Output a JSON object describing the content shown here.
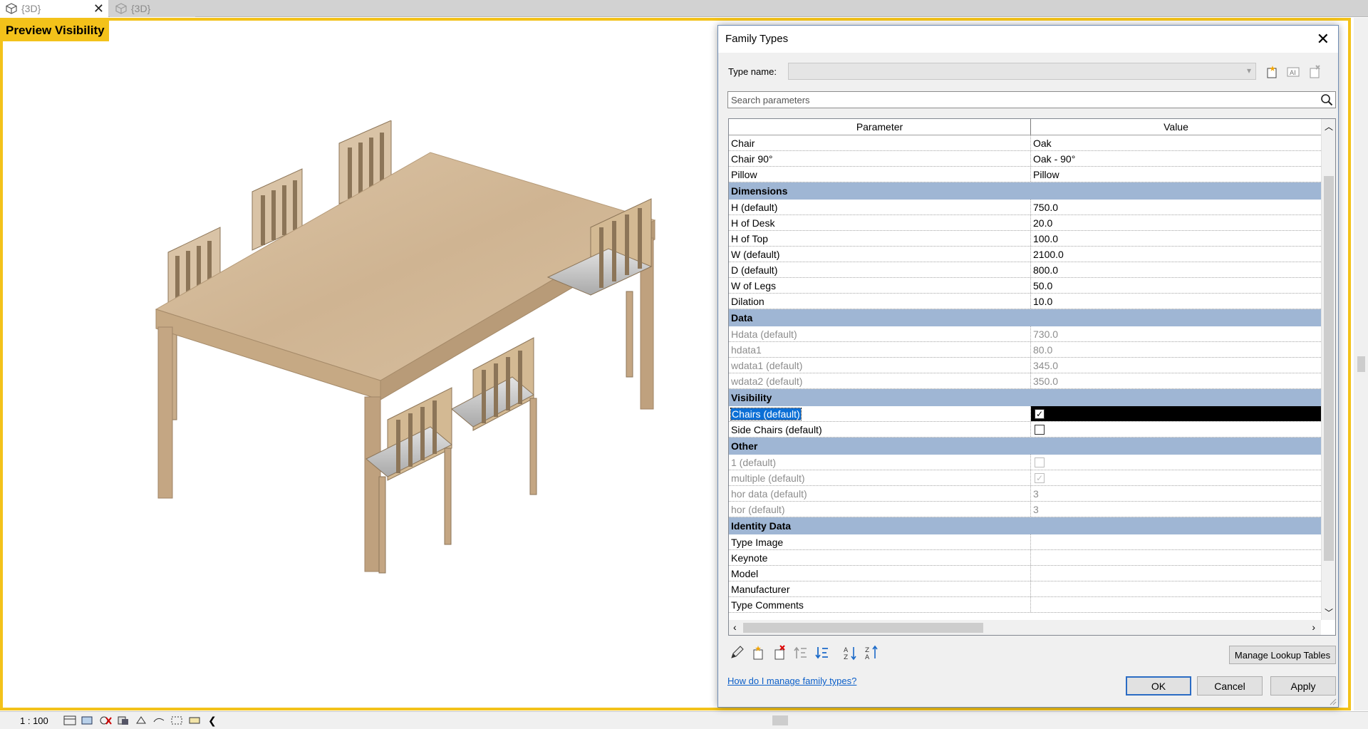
{
  "tabs": [
    {
      "label": "{3D}",
      "active": true
    },
    {
      "label": "{3D}",
      "active": false
    }
  ],
  "view": {
    "label": "Preview Visibility",
    "frame_color": "#f3c21a"
  },
  "statusbar": {
    "scale": "1 : 100",
    "icons": [
      "detail-level-icon",
      "visual-style-icon",
      "sun-path-icon",
      "shadows-icon",
      "render-icon",
      "crop-view-icon",
      "show-crop-icon",
      "temporary-hide-icon"
    ]
  },
  "dialog": {
    "title": "Family Types",
    "type_name_label": "Type name:",
    "type_name_value": "",
    "search_placeholder": "Search parameters",
    "columns": {
      "parameter": "Parameter",
      "value": "Value"
    },
    "rows": [
      {
        "kind": "param",
        "name": "Chair",
        "value": "Oak"
      },
      {
        "kind": "param",
        "name": "Chair 90°",
        "value": "Oak - 90°"
      },
      {
        "kind": "param",
        "name": "Pillow",
        "value": "Pillow"
      },
      {
        "kind": "group",
        "name": "Dimensions"
      },
      {
        "kind": "param",
        "name": "H (default)",
        "value": "750.0"
      },
      {
        "kind": "param",
        "name": "H of Desk",
        "value": "20.0"
      },
      {
        "kind": "param",
        "name": "H of Top",
        "value": "100.0"
      },
      {
        "kind": "param",
        "name": "W (default)",
        "value": "2100.0"
      },
      {
        "kind": "param",
        "name": "D (default)",
        "value": "800.0"
      },
      {
        "kind": "param",
        "name": "W of Legs",
        "value": "50.0"
      },
      {
        "kind": "param",
        "name": "Dilation",
        "value": "10.0"
      },
      {
        "kind": "group",
        "name": "Data"
      },
      {
        "kind": "param",
        "name": "Hdata (default)",
        "value": "730.0",
        "disabled": true
      },
      {
        "kind": "param",
        "name": "hdata1",
        "value": "80.0",
        "disabled": true
      },
      {
        "kind": "param",
        "name": "wdata1 (default)",
        "value": "345.0",
        "disabled": true
      },
      {
        "kind": "param",
        "name": "wdata2 (default)",
        "value": "350.0",
        "disabled": true
      },
      {
        "kind": "group",
        "name": "Visibility"
      },
      {
        "kind": "check",
        "name": "Chairs (default)",
        "checked": true,
        "selected": true
      },
      {
        "kind": "check",
        "name": "Side Chairs (default)",
        "checked": false
      },
      {
        "kind": "group",
        "name": "Other"
      },
      {
        "kind": "check",
        "name": "1 (default)",
        "checked": false,
        "disabled": true
      },
      {
        "kind": "check",
        "name": "multiple (default)",
        "checked": true,
        "disabled": true
      },
      {
        "kind": "param",
        "name": "hor data (default)",
        "value": "3",
        "disabled": true
      },
      {
        "kind": "param",
        "name": "hor (default)",
        "value": "3",
        "disabled": true
      },
      {
        "kind": "group",
        "name": "Identity Data"
      },
      {
        "kind": "param",
        "name": "Type Image",
        "value": ""
      },
      {
        "kind": "param",
        "name": "Keynote",
        "value": ""
      },
      {
        "kind": "param",
        "name": "Model",
        "value": ""
      },
      {
        "kind": "param",
        "name": "Manufacturer",
        "value": ""
      },
      {
        "kind": "param",
        "name": "Type Comments",
        "value": ""
      }
    ],
    "manage_lookup_label": "Manage Lookup Tables",
    "help_link": "How do I manage family types?",
    "ok_label": "OK",
    "cancel_label": "Cancel",
    "apply_label": "Apply",
    "group_color": "#9fb6d4",
    "selection_color": "#0b6fd6"
  }
}
